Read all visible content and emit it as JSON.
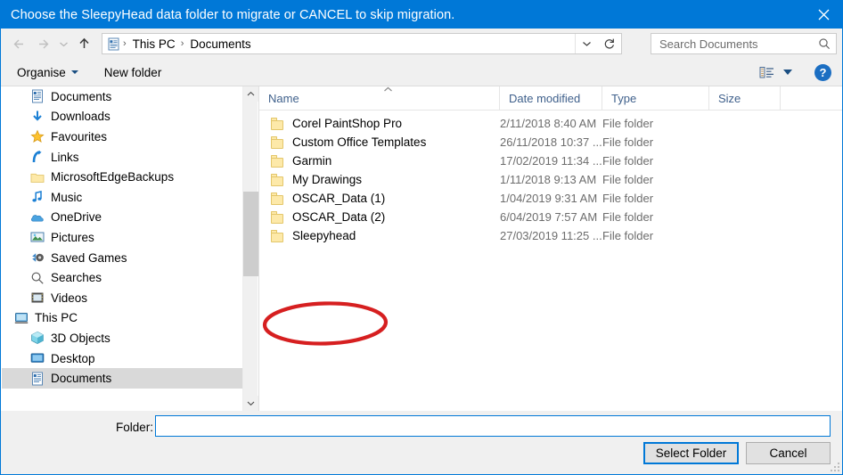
{
  "titlebar": {
    "title": "Choose the SleepyHead data folder to migrate or CANCEL to skip migration.",
    "close_label": "✕"
  },
  "nav": {
    "back_label": "←",
    "forward_label": "→",
    "recent_label": "⌄",
    "up_label": "↑",
    "breadcrumb": [
      {
        "label": "This PC"
      },
      {
        "label": "Documents"
      }
    ],
    "separator": "›"
  },
  "search": {
    "placeholder": "Search Documents",
    "value": ""
  },
  "toolbar": {
    "organise_label": "Organise",
    "new_folder_label": "New folder",
    "help_label": "?"
  },
  "sidebar": {
    "items": [
      {
        "label": "Documents",
        "icon": "documents-icon",
        "level": 1,
        "selected": false
      },
      {
        "label": "Downloads",
        "icon": "downloads-icon",
        "level": 1,
        "selected": false
      },
      {
        "label": "Favourites",
        "icon": "favourites-icon",
        "level": 1,
        "selected": false
      },
      {
        "label": "Links",
        "icon": "links-icon",
        "level": 1,
        "selected": false
      },
      {
        "label": "MicrosoftEdgeBackups",
        "icon": "folder-icon",
        "level": 1,
        "selected": false
      },
      {
        "label": "Music",
        "icon": "music-icon",
        "level": 1,
        "selected": false
      },
      {
        "label": "OneDrive",
        "icon": "onedrive-icon",
        "level": 1,
        "selected": false
      },
      {
        "label": "Pictures",
        "icon": "pictures-icon",
        "level": 1,
        "selected": false
      },
      {
        "label": "Saved Games",
        "icon": "saved-games-icon",
        "level": 1,
        "selected": false
      },
      {
        "label": "Searches",
        "icon": "searches-icon",
        "level": 1,
        "selected": false
      },
      {
        "label": "Videos",
        "icon": "videos-icon",
        "level": 1,
        "selected": false
      },
      {
        "label": "This PC",
        "icon": "this-pc-icon",
        "level": 0,
        "selected": false
      },
      {
        "label": "3D Objects",
        "icon": "3d-objects-icon",
        "level": 1,
        "selected": false
      },
      {
        "label": "Desktop",
        "icon": "desktop-icon",
        "level": 1,
        "selected": false
      },
      {
        "label": "Documents",
        "icon": "documents-icon",
        "level": 1,
        "selected": true
      }
    ]
  },
  "filelist": {
    "columns": [
      "Name",
      "Date modified",
      "Type",
      "Size"
    ],
    "sort_column": "Name",
    "sort_direction": "ascending",
    "rows": [
      {
        "name": "Corel PaintShop Pro",
        "date": "2/11/2018 8:40 AM",
        "type": "File folder",
        "size": ""
      },
      {
        "name": "Custom Office Templates",
        "date": "26/11/2018 10:37 ...",
        "type": "File folder",
        "size": ""
      },
      {
        "name": "Garmin",
        "date": "17/02/2019 11:34 ...",
        "type": "File folder",
        "size": ""
      },
      {
        "name": "My Drawings",
        "date": "1/11/2018 9:13 AM",
        "type": "File folder",
        "size": ""
      },
      {
        "name": "OSCAR_Data (1)",
        "date": "1/04/2019 9:31 AM",
        "type": "File folder",
        "size": ""
      },
      {
        "name": "OSCAR_Data (2)",
        "date": "6/04/2019 7:57 AM",
        "type": "File folder",
        "size": ""
      },
      {
        "name": "Sleepyhead",
        "date": "27/03/2019 11:25 ...",
        "type": "File folder",
        "size": ""
      }
    ]
  },
  "annotation": {
    "shape": "ellipse",
    "color": "#d61f20",
    "target": "Sleepyhead"
  },
  "footer": {
    "folder_label": "Folder:",
    "folder_value": "",
    "select_label": "Select Folder",
    "cancel_label": "Cancel"
  },
  "colors": {
    "titlebar": "#0078d7",
    "accent": "#0078d7",
    "annotation": "#d61f20",
    "folder_icon": "#fde9a9"
  }
}
